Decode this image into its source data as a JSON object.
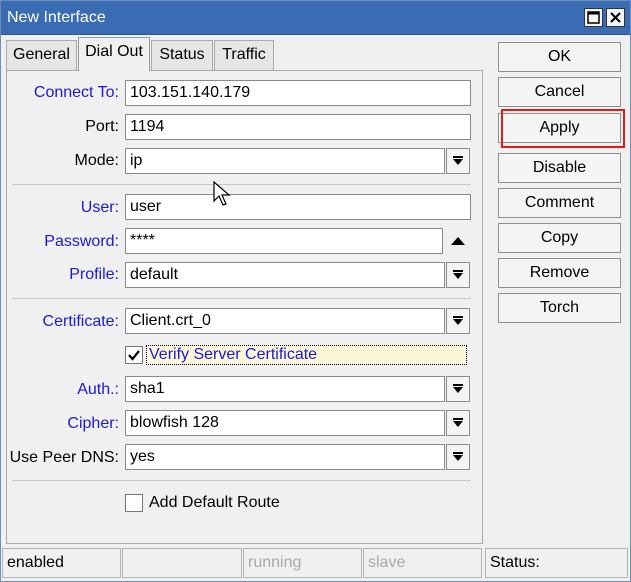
{
  "window": {
    "title": "New Interface"
  },
  "tabs": [
    {
      "label": "General"
    },
    {
      "label": "Dial Out"
    },
    {
      "label": "Status"
    },
    {
      "label": "Traffic"
    }
  ],
  "form": {
    "connect_to": {
      "label": "Connect To:",
      "value": "103.151.140.179"
    },
    "port": {
      "label": "Port:",
      "value": "1194"
    },
    "mode": {
      "label": "Mode:",
      "value": "ip"
    },
    "user": {
      "label": "User:",
      "value": "user"
    },
    "password": {
      "label": "Password:",
      "value": "****"
    },
    "profile": {
      "label": "Profile:",
      "value": "default"
    },
    "certificate": {
      "label": "Certificate:",
      "value": "Client.crt_0"
    },
    "verify_server_certificate": {
      "label": "Verify Server Certificate",
      "checked": true
    },
    "auth": {
      "label": "Auth.:",
      "value": "sha1"
    },
    "cipher": {
      "label": "Cipher:",
      "value": "blowfish 128"
    },
    "use_peer_dns": {
      "label": "Use Peer DNS:",
      "value": "yes"
    },
    "add_default_route": {
      "label": "Add Default Route",
      "checked": false
    }
  },
  "buttons": {
    "ok": "OK",
    "cancel": "Cancel",
    "apply": "Apply",
    "disable": "Disable",
    "comment": "Comment",
    "copy": "Copy",
    "remove": "Remove",
    "torch": "Torch"
  },
  "statusbar": {
    "state": "enabled",
    "running": "running",
    "slave": "slave",
    "status_label": "Status:"
  },
  "colors": {
    "titlebar": "#3a6cb3",
    "label_blue": "#1a1ad6",
    "highlight_red": "#e0191e"
  }
}
